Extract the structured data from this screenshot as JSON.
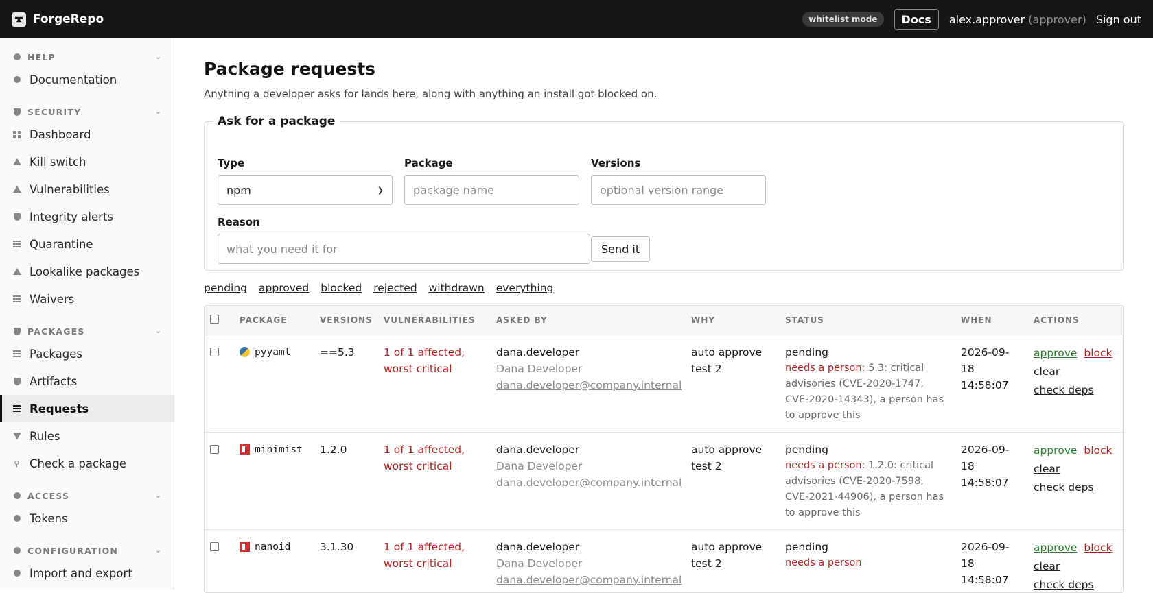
{
  "topbar": {
    "brand": "ForgeRepo",
    "mode_badge": "whitelist mode",
    "docs_label": "Docs",
    "username": "alex.approver",
    "role": "(approver)",
    "signout": "Sign out"
  },
  "sidebar": {
    "help": {
      "title": "HELP",
      "items": [
        "Documentation"
      ]
    },
    "security": {
      "title": "SECURITY",
      "items": [
        "Dashboard",
        "Kill switch",
        "Vulnerabilities",
        "Integrity alerts",
        "Quarantine",
        "Lookalike packages",
        "Waivers"
      ]
    },
    "packages": {
      "title": "PACKAGES",
      "items": [
        "Packages",
        "Artifacts",
        "Requests",
        "Rules",
        "Check a package"
      ]
    },
    "access": {
      "title": "ACCESS",
      "items": [
        "Tokens"
      ]
    },
    "configuration": {
      "title": "CONFIGURATION",
      "items": [
        "Import and export"
      ]
    }
  },
  "page": {
    "title": "Package requests",
    "subtitle": "Anything a developer asks for lands here, along with anything an install got blocked on."
  },
  "ask_form": {
    "legend": "Ask for a package",
    "type_label": "Type",
    "type_value": "npm",
    "package_label": "Package",
    "package_placeholder": "package name",
    "versions_label": "Versions",
    "versions_placeholder": "optional version range",
    "reason_label": "Reason",
    "reason_placeholder": "what you need it for",
    "send_label": "Send it"
  },
  "filters": [
    "pending",
    "approved",
    "blocked",
    "rejected",
    "withdrawn",
    "everything"
  ],
  "table": {
    "headers": [
      "PACKAGE",
      "VERSIONS",
      "VULNERABILITIES",
      "ASKED BY",
      "WHY",
      "STATUS",
      "WHEN",
      "ACTIONS"
    ],
    "rows": [
      {
        "ecosystem_icon": "python-icon",
        "package": "pyyaml",
        "versions": "==5.3",
        "vulnerabilities": "1 of 1 affected, worst critical",
        "asked_by_user": "dana.developer",
        "asked_by_name": "Dana Developer",
        "asked_by_email": "dana.developer@company.internal",
        "why": "auto approve test 2",
        "status": "pending",
        "status_needs": "needs a person",
        "status_detail": ": 5.3: critical advisories (CVE-2020-1747, CVE-2020-14343), a person has to approve this",
        "when": "2026-09-18 14:58:07",
        "approve": "approve",
        "block": "block",
        "clear": "clear",
        "check_deps": "check deps"
      },
      {
        "ecosystem_icon": "npm-icon",
        "package": "minimist",
        "versions": "1.2.0",
        "vulnerabilities": "1 of 1 affected, worst critical",
        "asked_by_user": "dana.developer",
        "asked_by_name": "Dana Developer",
        "asked_by_email": "dana.developer@company.internal",
        "why": "auto approve test 2",
        "status": "pending",
        "status_needs": "needs a person",
        "status_detail": ": 1.2.0: critical advisories (CVE-2020-7598, CVE-2021-44906), a person has to approve this",
        "when": "2026-09-18 14:58:07",
        "approve": "approve",
        "block": "block",
        "clear": "clear",
        "check_deps": "check deps"
      },
      {
        "ecosystem_icon": "npm-icon",
        "package": "nanoid",
        "versions": "3.1.30",
        "vulnerabilities": "1 of 1 affected, worst critical",
        "asked_by_user": "dana.developer",
        "asked_by_name": "Dana Developer",
        "asked_by_email": "dana.developer@company.internal",
        "why": "auto approve test 2",
        "status": "pending",
        "status_needs": "needs a person",
        "status_detail": "",
        "when": "2026-09-18 14:58:07",
        "approve": "approve",
        "block": "block",
        "clear": "clear",
        "check_deps": "check deps"
      }
    ]
  },
  "colors": {
    "topbar_bg": "#161616",
    "danger": "#b32424",
    "approve": "#2e7d32"
  }
}
